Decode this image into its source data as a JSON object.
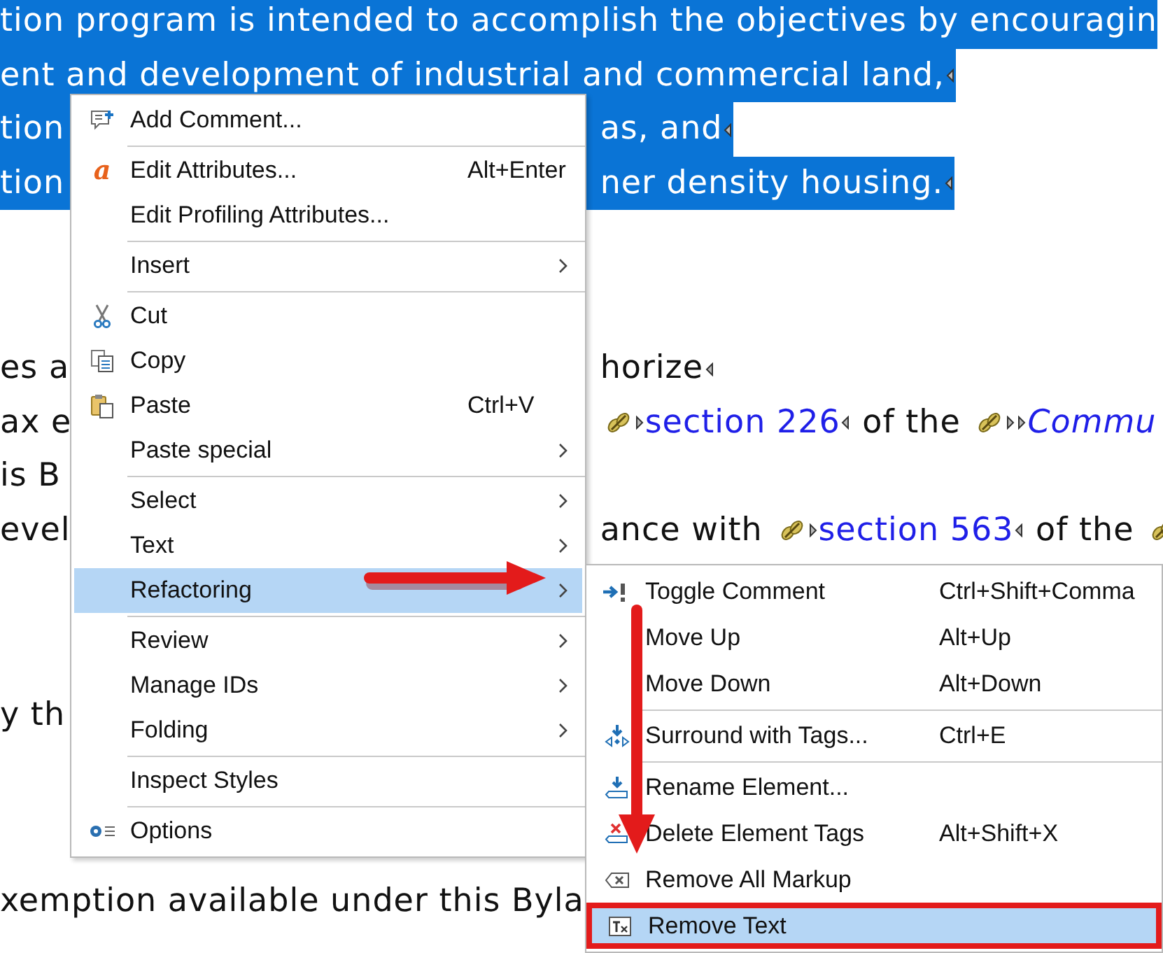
{
  "document": {
    "paragraphs": [
      {
        "selected": true,
        "lines": [
          {
            "left": [
              {
                "kind": "text",
                "text": "tion program is intended to accomplish the objectives by encouragin"
              }
            ]
          },
          {
            "left": [
              {
                "kind": "text",
                "text": "ent and development of industrial and commercial land,"
              },
              {
                "kind": "end-marker"
              }
            ]
          },
          {
            "left": [
              {
                "kind": "text",
                "text": "tion"
              }
            ],
            "right": [
              {
                "kind": "text",
                "text": "as, and"
              },
              {
                "kind": "end-marker"
              }
            ]
          },
          {
            "left": [
              {
                "kind": "text",
                "text": "tion"
              }
            ],
            "right": [
              {
                "kind": "text",
                "text": "ner density housing."
              },
              {
                "kind": "end-marker"
              }
            ]
          }
        ]
      },
      {
        "selected": false,
        "lines": [
          {
            "left": [
              {
                "kind": "text",
                "text": "es a"
              }
            ],
            "right": [
              {
                "kind": "text",
                "text": "horize"
              },
              {
                "kind": "end-marker"
              }
            ]
          },
          {
            "left": [
              {
                "kind": "text",
                "text": "ax e"
              }
            ],
            "right": [
              {
                "kind": "reference-icon"
              },
              {
                "kind": "start-marker"
              },
              {
                "kind": "link",
                "text": "section 226"
              },
              {
                "kind": "end-marker"
              },
              {
                "kind": "text",
                "text": " of the "
              },
              {
                "kind": "reference-icon"
              },
              {
                "kind": "start-marker"
              },
              {
                "kind": "start-marker"
              },
              {
                "kind": "title-link",
                "text": "Commu"
              }
            ]
          },
          {
            "left": [
              {
                "kind": "text",
                "text": "is B"
              }
            ]
          },
          {
            "left": [
              {
                "kind": "text",
                "text": "evel"
              }
            ],
            "right": [
              {
                "kind": "text",
                "text": "ance with "
              },
              {
                "kind": "reference-icon"
              },
              {
                "kind": "start-marker"
              },
              {
                "kind": "link",
                "text": "section 563"
              },
              {
                "kind": "end-marker"
              },
              {
                "kind": "text",
                "text": " of the "
              },
              {
                "kind": "reference-icon"
              }
            ]
          }
        ]
      },
      {
        "selected": false,
        "lines": [
          {
            "left": [
              {
                "kind": "text",
                "text": "y th"
              }
            ]
          }
        ]
      },
      {
        "selected": false,
        "lines": [
          {
            "left": [
              {
                "kind": "text",
                "text": "xemption available under this Byla"
              }
            ]
          }
        ]
      }
    ]
  },
  "context_menu": {
    "groups": [
      [
        {
          "label": "Add Comment...",
          "selected": false,
          "has_submenu": false
        }
      ],
      [
        {
          "label": "Edit Attributes...",
          "shortcut": "Alt+Enter",
          "icon_text": "a",
          "selected": false,
          "has_submenu": false
        },
        {
          "label": "Edit Profiling Attributes...",
          "selected": false,
          "has_submenu": false
        }
      ],
      [
        {
          "label": "Insert",
          "selected": false,
          "has_submenu": true
        }
      ],
      [
        {
          "label": "Cut",
          "selected": false,
          "has_submenu": false
        },
        {
          "label": "Copy",
          "selected": false,
          "has_submenu": false
        },
        {
          "label": "Paste",
          "shortcut": "Ctrl+V",
          "selected": false,
          "has_submenu": false
        },
        {
          "label": "Paste special",
          "selected": false,
          "has_submenu": true
        }
      ],
      [
        {
          "label": "Select",
          "selected": false,
          "has_submenu": true
        },
        {
          "label": "Text",
          "selected": false,
          "has_submenu": true
        },
        {
          "label": "Refactoring",
          "selected": true,
          "has_submenu": true
        }
      ],
      [
        {
          "label": "Review",
          "selected": false,
          "has_submenu": true
        },
        {
          "label": "Manage IDs",
          "selected": false,
          "has_submenu": true
        },
        {
          "label": "Folding",
          "selected": false,
          "has_submenu": true
        }
      ],
      [
        {
          "label": "Inspect Styles",
          "selected": false,
          "has_submenu": false
        }
      ],
      [
        {
          "label": "Options",
          "selected": false,
          "has_submenu": false
        }
      ]
    ]
  },
  "submenu": {
    "groups": [
      [
        {
          "label": "Toggle Comment",
          "shortcut": "Ctrl+Shift+Comma",
          "selected": false,
          "annotated": false
        },
        {
          "label": "Move Up",
          "shortcut": "Alt+Up",
          "selected": false,
          "annotated": false
        },
        {
          "label": "Move Down",
          "shortcut": "Alt+Down",
          "selected": false,
          "annotated": false
        }
      ],
      [
        {
          "label": "Surround with Tags...",
          "shortcut": "Ctrl+E",
          "selected": false,
          "annotated": false
        }
      ],
      [
        {
          "label": "Rename Element...",
          "selected": false,
          "annotated": false
        },
        {
          "label": "Delete Element Tags",
          "shortcut": "Alt+Shift+X",
          "selected": false,
          "annotated": false
        },
        {
          "label": "Remove All Markup",
          "selected": false,
          "annotated": false
        },
        {
          "label": "Remove Text",
          "selected": true,
          "annotated": true
        }
      ]
    ]
  }
}
